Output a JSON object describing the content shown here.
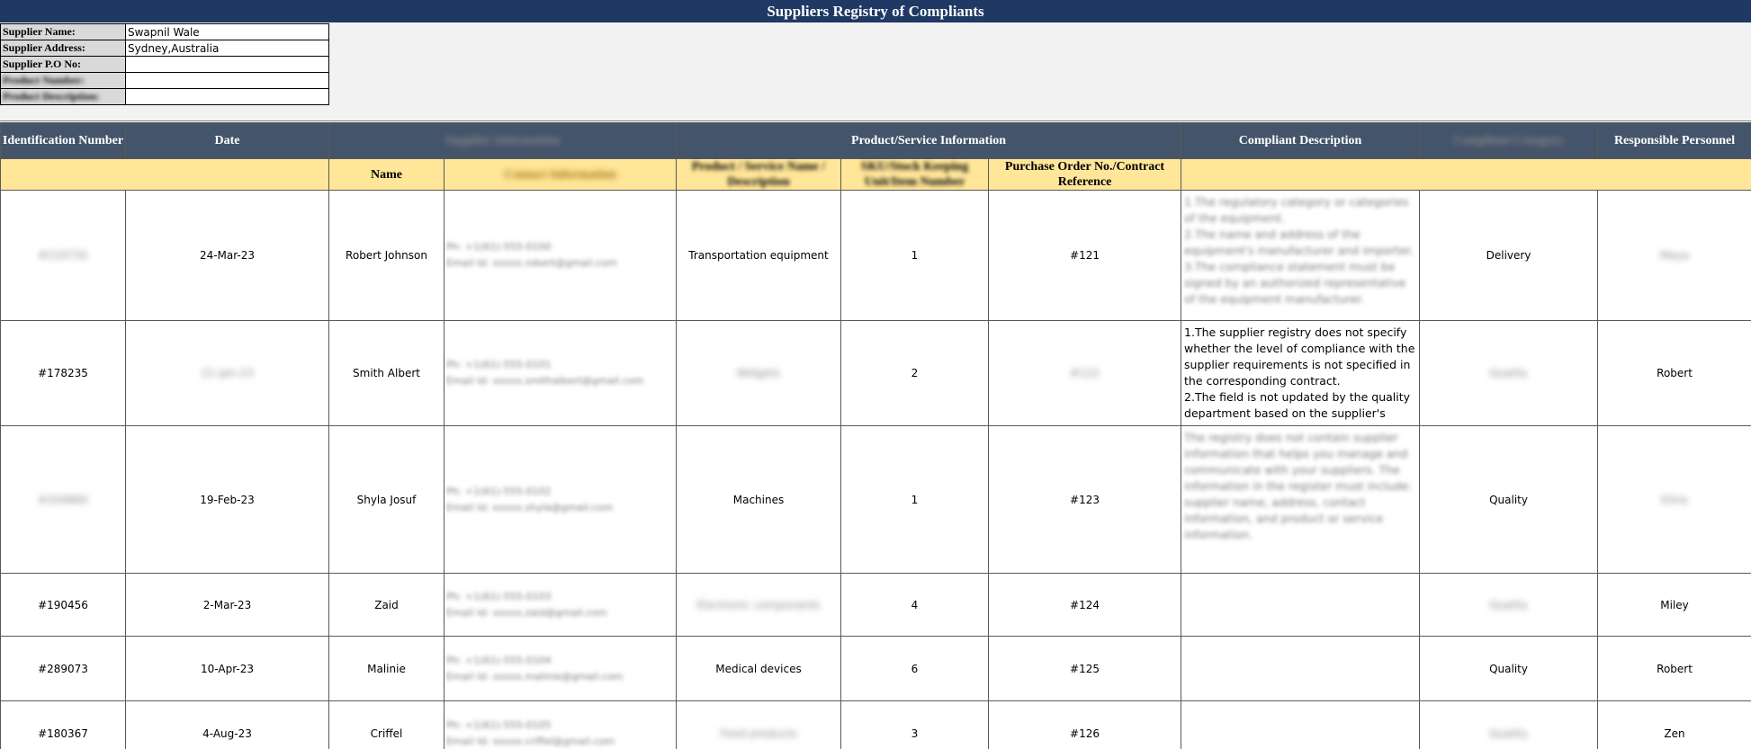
{
  "title": "Suppliers Registry of Compliants",
  "supplier_info": [
    {
      "label": "Supplier Name:",
      "value": "Swapnil Wale"
    },
    {
      "label": "Supplier Address:",
      "value": "Sydney,Australia"
    },
    {
      "label": "Supplier P.O No:",
      "value": ""
    },
    {
      "label": "Product Number:",
      "value": ""
    },
    {
      "label": "Product Description:",
      "value": ""
    }
  ],
  "headers": {
    "identification_number": "Identification Number",
    "date": "Date",
    "supplier_information": "Supplier Information",
    "product_service_information": "Product/Service Information",
    "compliant_description": "Compliant Description",
    "compliant_category": "Compliant Category",
    "responsible_personnel": "Responsible Personnel"
  },
  "subheaders": {
    "name": "Name",
    "contact_information": "Contact Information",
    "product_service_name_description": "Product / Service Name / Description",
    "stock_unit": "SKU/Stock Keeping Unit/Item Number",
    "purchase_order": "Purchase Order No./Contract Reference"
  },
  "rows": [
    {
      "id": "#210735",
      "date": "24-Mar-23",
      "name": "Robert Johnson",
      "phone": "Ph: +1(61)-555-0100",
      "email": "Email Id: xxxxx.robert@gmail.com",
      "product": "Transportation equipment",
      "sku": "1",
      "po": "#121",
      "description": "1.The regulatory category or categories of the equipment.\n2.The name and address of the equipment's manufacturer and importer.\n3.The compliance statement must be signed by an authorized representative of the equipment manufacturer.",
      "category": "Delivery",
      "personnel": "Maya"
    },
    {
      "id": "#178235",
      "date": "21-Jan-23",
      "name": "Smith Albert",
      "phone": "Ph: +1(61)-555-0101",
      "email": "Email Id: xxxxx.smithalbert@gmail.com",
      "product": "Widgets",
      "sku": "2",
      "po": "#122",
      "description": "1.The supplier registry does not specify whether the level of compliance with the supplier requirements is not specified in the corresponding contract.\n2.The field is not updated by the quality department based on the supplier's",
      "category": "Quality",
      "personnel": "Robert"
    },
    {
      "id": "#204860",
      "date": "19-Feb-23",
      "name": "Shyla Josuf",
      "phone": "Ph: +1(61)-555-0102",
      "email": "Email Id: xxxxx.shyla@gmail.com",
      "product": "Machines",
      "sku": "1",
      "po": "#123",
      "description": "The registry does not contain supplier information that helps you manage and communicate with your suppliers. The information in the register must include: supplier name, address, contact information, and product or service information.",
      "category": "Quality",
      "personnel": "Elina"
    },
    {
      "id": "#190456",
      "date": "2-Mar-23",
      "name": "Zaid",
      "phone": "Ph: +1(61)-555-0103",
      "email": "Email Id: xxxxx.zaid@gmail.com",
      "product": "Electronic components",
      "sku": "4",
      "po": "#124",
      "description": "",
      "category": "Quality",
      "personnel": "Miley"
    },
    {
      "id": "#289073",
      "date": "10-Apr-23",
      "name": "Malinie",
      "phone": "Ph: +1(61)-555-0104",
      "email": "Email Id: xxxxx.malinie@gmail.com",
      "product": "Medical devices",
      "sku": "6",
      "po": "#125",
      "description": "",
      "category": "Quality",
      "personnel": "Robert"
    },
    {
      "id": "#180367",
      "date": "4-Aug-23",
      "name": "Criffel",
      "phone": "Ph: +1(61)-555-0105",
      "email": "Email Id: xxxxx.criffel@gmail.com",
      "product": "Food products",
      "sku": "3",
      "po": "#126",
      "description": "",
      "category": "Quality",
      "personnel": "Zen"
    }
  ]
}
